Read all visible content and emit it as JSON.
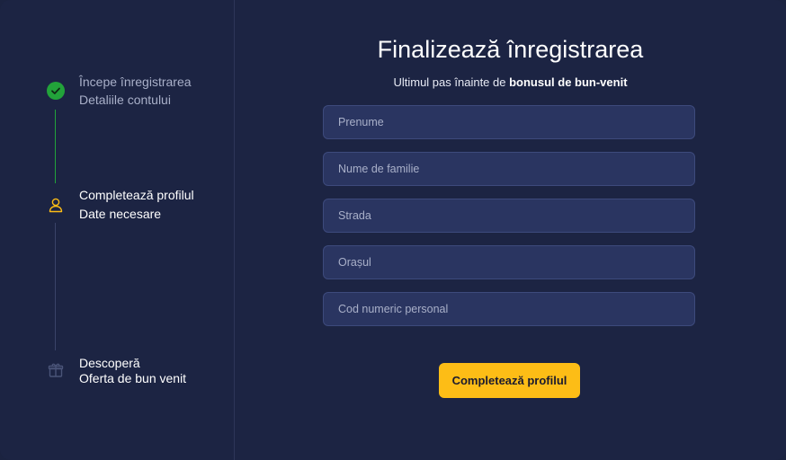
{
  "colors": {
    "background": "#1c2443",
    "accent": "#fdbd16",
    "success": "#22a33a",
    "field_bg": "#2a3561"
  },
  "sidebar": {
    "steps": [
      {
        "line1": "Începe înregistrarea",
        "line2": "Detaliile contului",
        "icon": "check-circle-icon",
        "state": "completed"
      },
      {
        "line1": "Completează profilul",
        "line2": "Date necesare",
        "icon": "user-icon",
        "state": "active"
      },
      {
        "line1": "Descoperă",
        "line2": "Oferta de bun venit",
        "icon": "gift-icon",
        "state": "pending"
      }
    ]
  },
  "main": {
    "title": "Finalizează înregistrarea",
    "subtitle_prefix": "Ultimul pas înainte de ",
    "subtitle_bold": "bonusul de bun-venit",
    "fields": [
      {
        "placeholder": "Prenume",
        "value": ""
      },
      {
        "placeholder": "Nume de familie",
        "value": ""
      },
      {
        "placeholder": "Strada",
        "value": ""
      },
      {
        "placeholder": "Orașul",
        "value": ""
      },
      {
        "placeholder": "Cod numeric personal",
        "value": ""
      }
    ],
    "submit_label": "Completează profilul"
  }
}
